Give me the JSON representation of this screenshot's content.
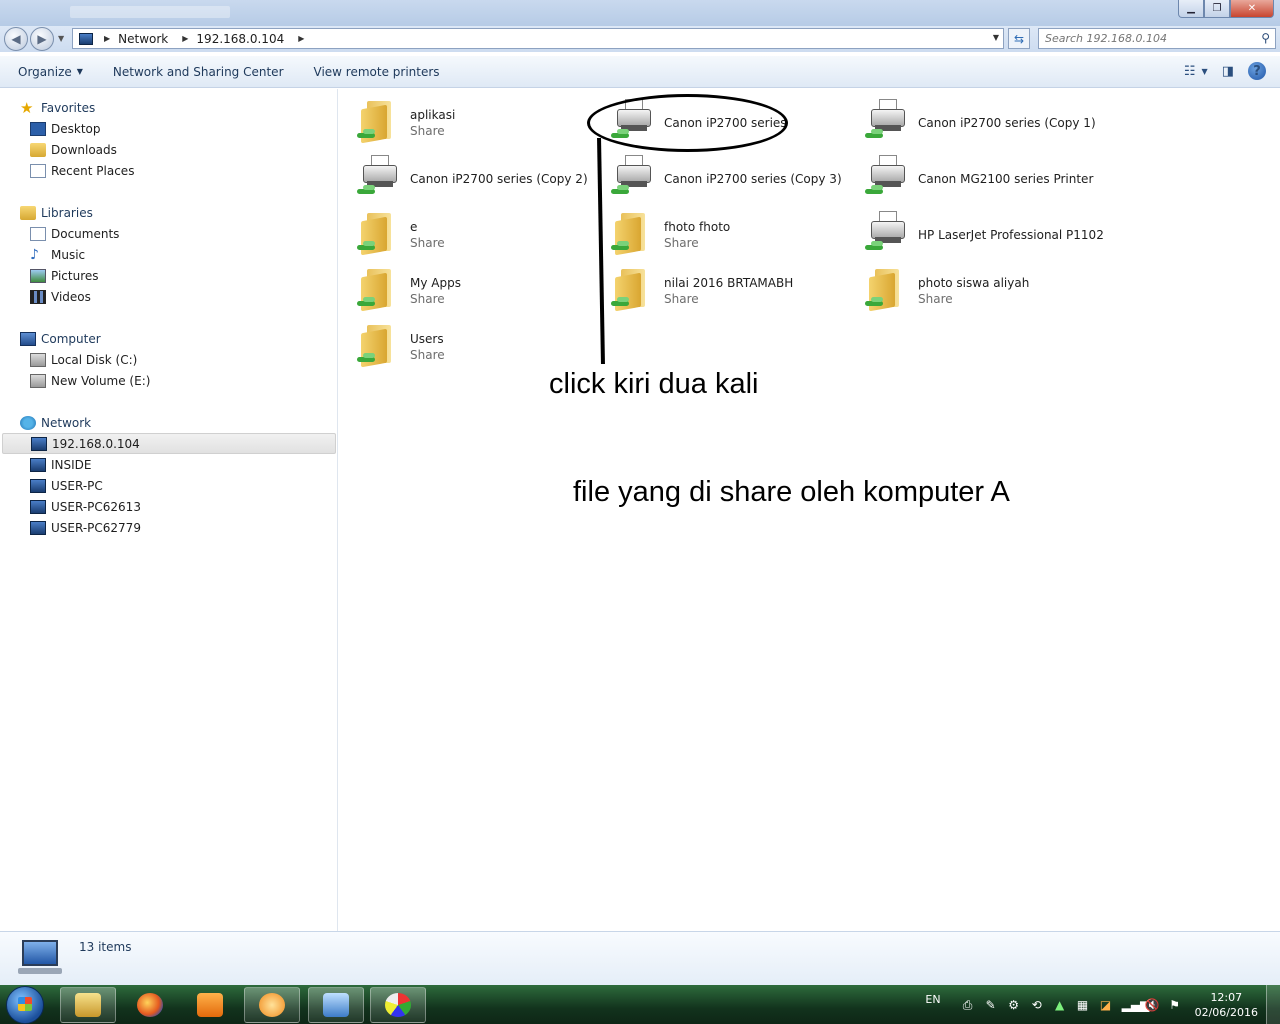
{
  "address": {
    "segments": [
      "Network",
      "192.168.0.104"
    ]
  },
  "search": {
    "placeholder": "Search 192.168.0.104"
  },
  "toolbar": {
    "organize": "Organize",
    "network_sharing": "Network and Sharing Center",
    "remote_printers": "View remote printers"
  },
  "sidebar": {
    "favorites": {
      "title": "Favorites",
      "items": [
        "Desktop",
        "Downloads",
        "Recent Places"
      ]
    },
    "libraries": {
      "title": "Libraries",
      "items": [
        "Documents",
        "Music",
        "Pictures",
        "Videos"
      ]
    },
    "computer": {
      "title": "Computer",
      "items": [
        "Local Disk (C:)",
        "New Volume (E:)"
      ]
    },
    "network": {
      "title": "Network",
      "items": [
        "192.168.0.104",
        "INSIDE",
        "USER-PC",
        "USER-PC62613",
        "USER-PC62779"
      ]
    }
  },
  "items": [
    {
      "name": "aplikasi",
      "sub": "Share"
    },
    {
      "name": "Canon iP2700 series"
    },
    {
      "name": "Canon iP2700 series (Copy 1)"
    },
    {
      "name": "Canon iP2700 series (Copy 2)"
    },
    {
      "name": "Canon iP2700 series (Copy 3)"
    },
    {
      "name": "Canon MG2100 series Printer"
    },
    {
      "name": "e",
      "sub": "Share"
    },
    {
      "name": "fhoto fhoto",
      "sub": "Share"
    },
    {
      "name": "HP LaserJet Professional P1102"
    },
    {
      "name": "My Apps",
      "sub": "Share"
    },
    {
      "name": "nilai 2016 BRTAMABH",
      "sub": "Share"
    },
    {
      "name": "photo siswa aliyah",
      "sub": "Share"
    },
    {
      "name": "Users",
      "sub": "Share"
    }
  ],
  "annotations": {
    "note1": "click kiri dua kali",
    "note2": "file yang di share oleh komputer A"
  },
  "details": {
    "count": "13 items"
  },
  "taskbar": {
    "lang": "EN",
    "time": "12:07",
    "date": "02/06/2016"
  },
  "icons": {
    "folder": "shared-folder-icon",
    "printer": "network-printer-icon"
  }
}
